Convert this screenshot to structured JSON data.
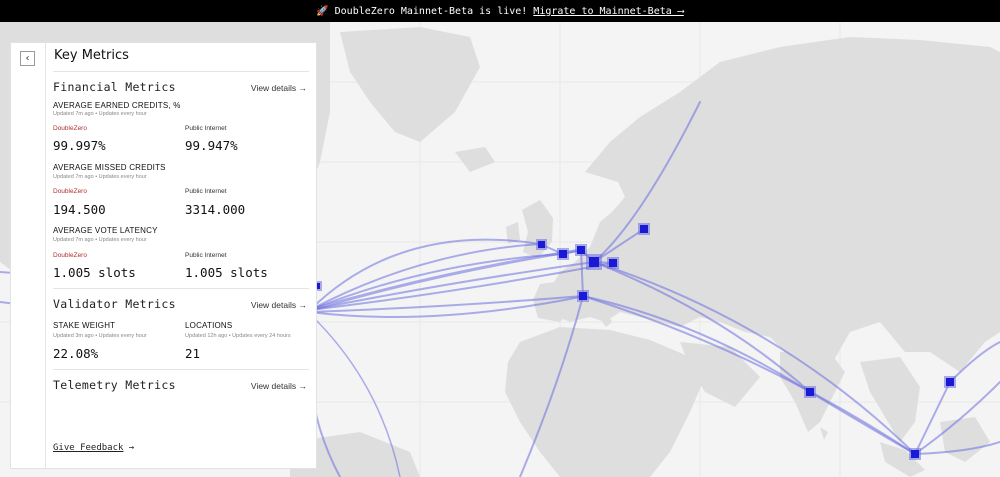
{
  "banner": {
    "rocket": "🚀",
    "message": "DoubleZero Mainnet-Beta is live!",
    "link": "Migrate to Mainnet-Beta ⟶"
  },
  "panel": {
    "collapse_icon": "chevron-left-icon",
    "title": "Key Metrics",
    "financial": {
      "title": "Financial Metrics",
      "view_details": "View details →",
      "earned": {
        "label": "AVERAGE EARNED CREDITS, %",
        "updated": "Updated 7m ago • Updates every hour",
        "dz_label": "DoubleZero",
        "pi_label": "Public Internet",
        "dz_value": "99.997%",
        "pi_value": "99.947%"
      },
      "missed": {
        "label": "AVERAGE MISSED CREDITS",
        "updated": "Updated 7m ago • Updates every hour",
        "dz_label": "DoubleZero",
        "pi_label": "Public Internet",
        "dz_value": "194.500",
        "pi_value": "3314.000"
      },
      "latency": {
        "label": "AVERAGE VOTE LATENCY",
        "updated": "Updated 7m ago • Updates every hour",
        "dz_label": "DoubleZero",
        "pi_label": "Public Internet",
        "dz_value": "1.005 slots",
        "pi_value": "1.005 slots"
      }
    },
    "validator": {
      "title": "Validator Metrics",
      "view_details": "View details →",
      "stake_label": "STAKE WEIGHT",
      "stake_updated": "Updated 3m ago • Updates every hour",
      "stake_value": "22.08%",
      "locations_label": "LOCATIONS",
      "locations_updated": "Updated 12h ago • Updates every 24 hours",
      "locations_value": "21"
    },
    "telemetry": {
      "title": "Telemetry Metrics",
      "view_details": "View details →"
    },
    "feedback": {
      "label": "Give Feedback",
      "arrow": "→"
    }
  },
  "map": {
    "land_color": "#dedede",
    "ocean_color": "#f4f4f4",
    "route_color": "#6b6fe0",
    "node_color": "#1a1ad6"
  }
}
